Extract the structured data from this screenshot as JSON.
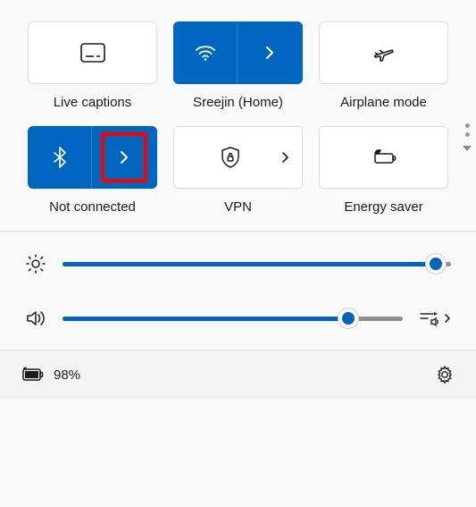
{
  "tiles": {
    "live_captions": {
      "label": "Live captions"
    },
    "wifi": {
      "label": "Sreejin (Home)"
    },
    "airplane": {
      "label": "Airplane mode"
    },
    "bluetooth": {
      "label": "Not connected"
    },
    "vpn": {
      "label": "VPN"
    },
    "energy_saver": {
      "label": "Energy saver"
    }
  },
  "sliders": {
    "brightness": {
      "percent": 96
    },
    "volume": {
      "percent": 84
    }
  },
  "footer": {
    "battery_text": "98%"
  },
  "colors": {
    "accent": "#0067c0"
  }
}
